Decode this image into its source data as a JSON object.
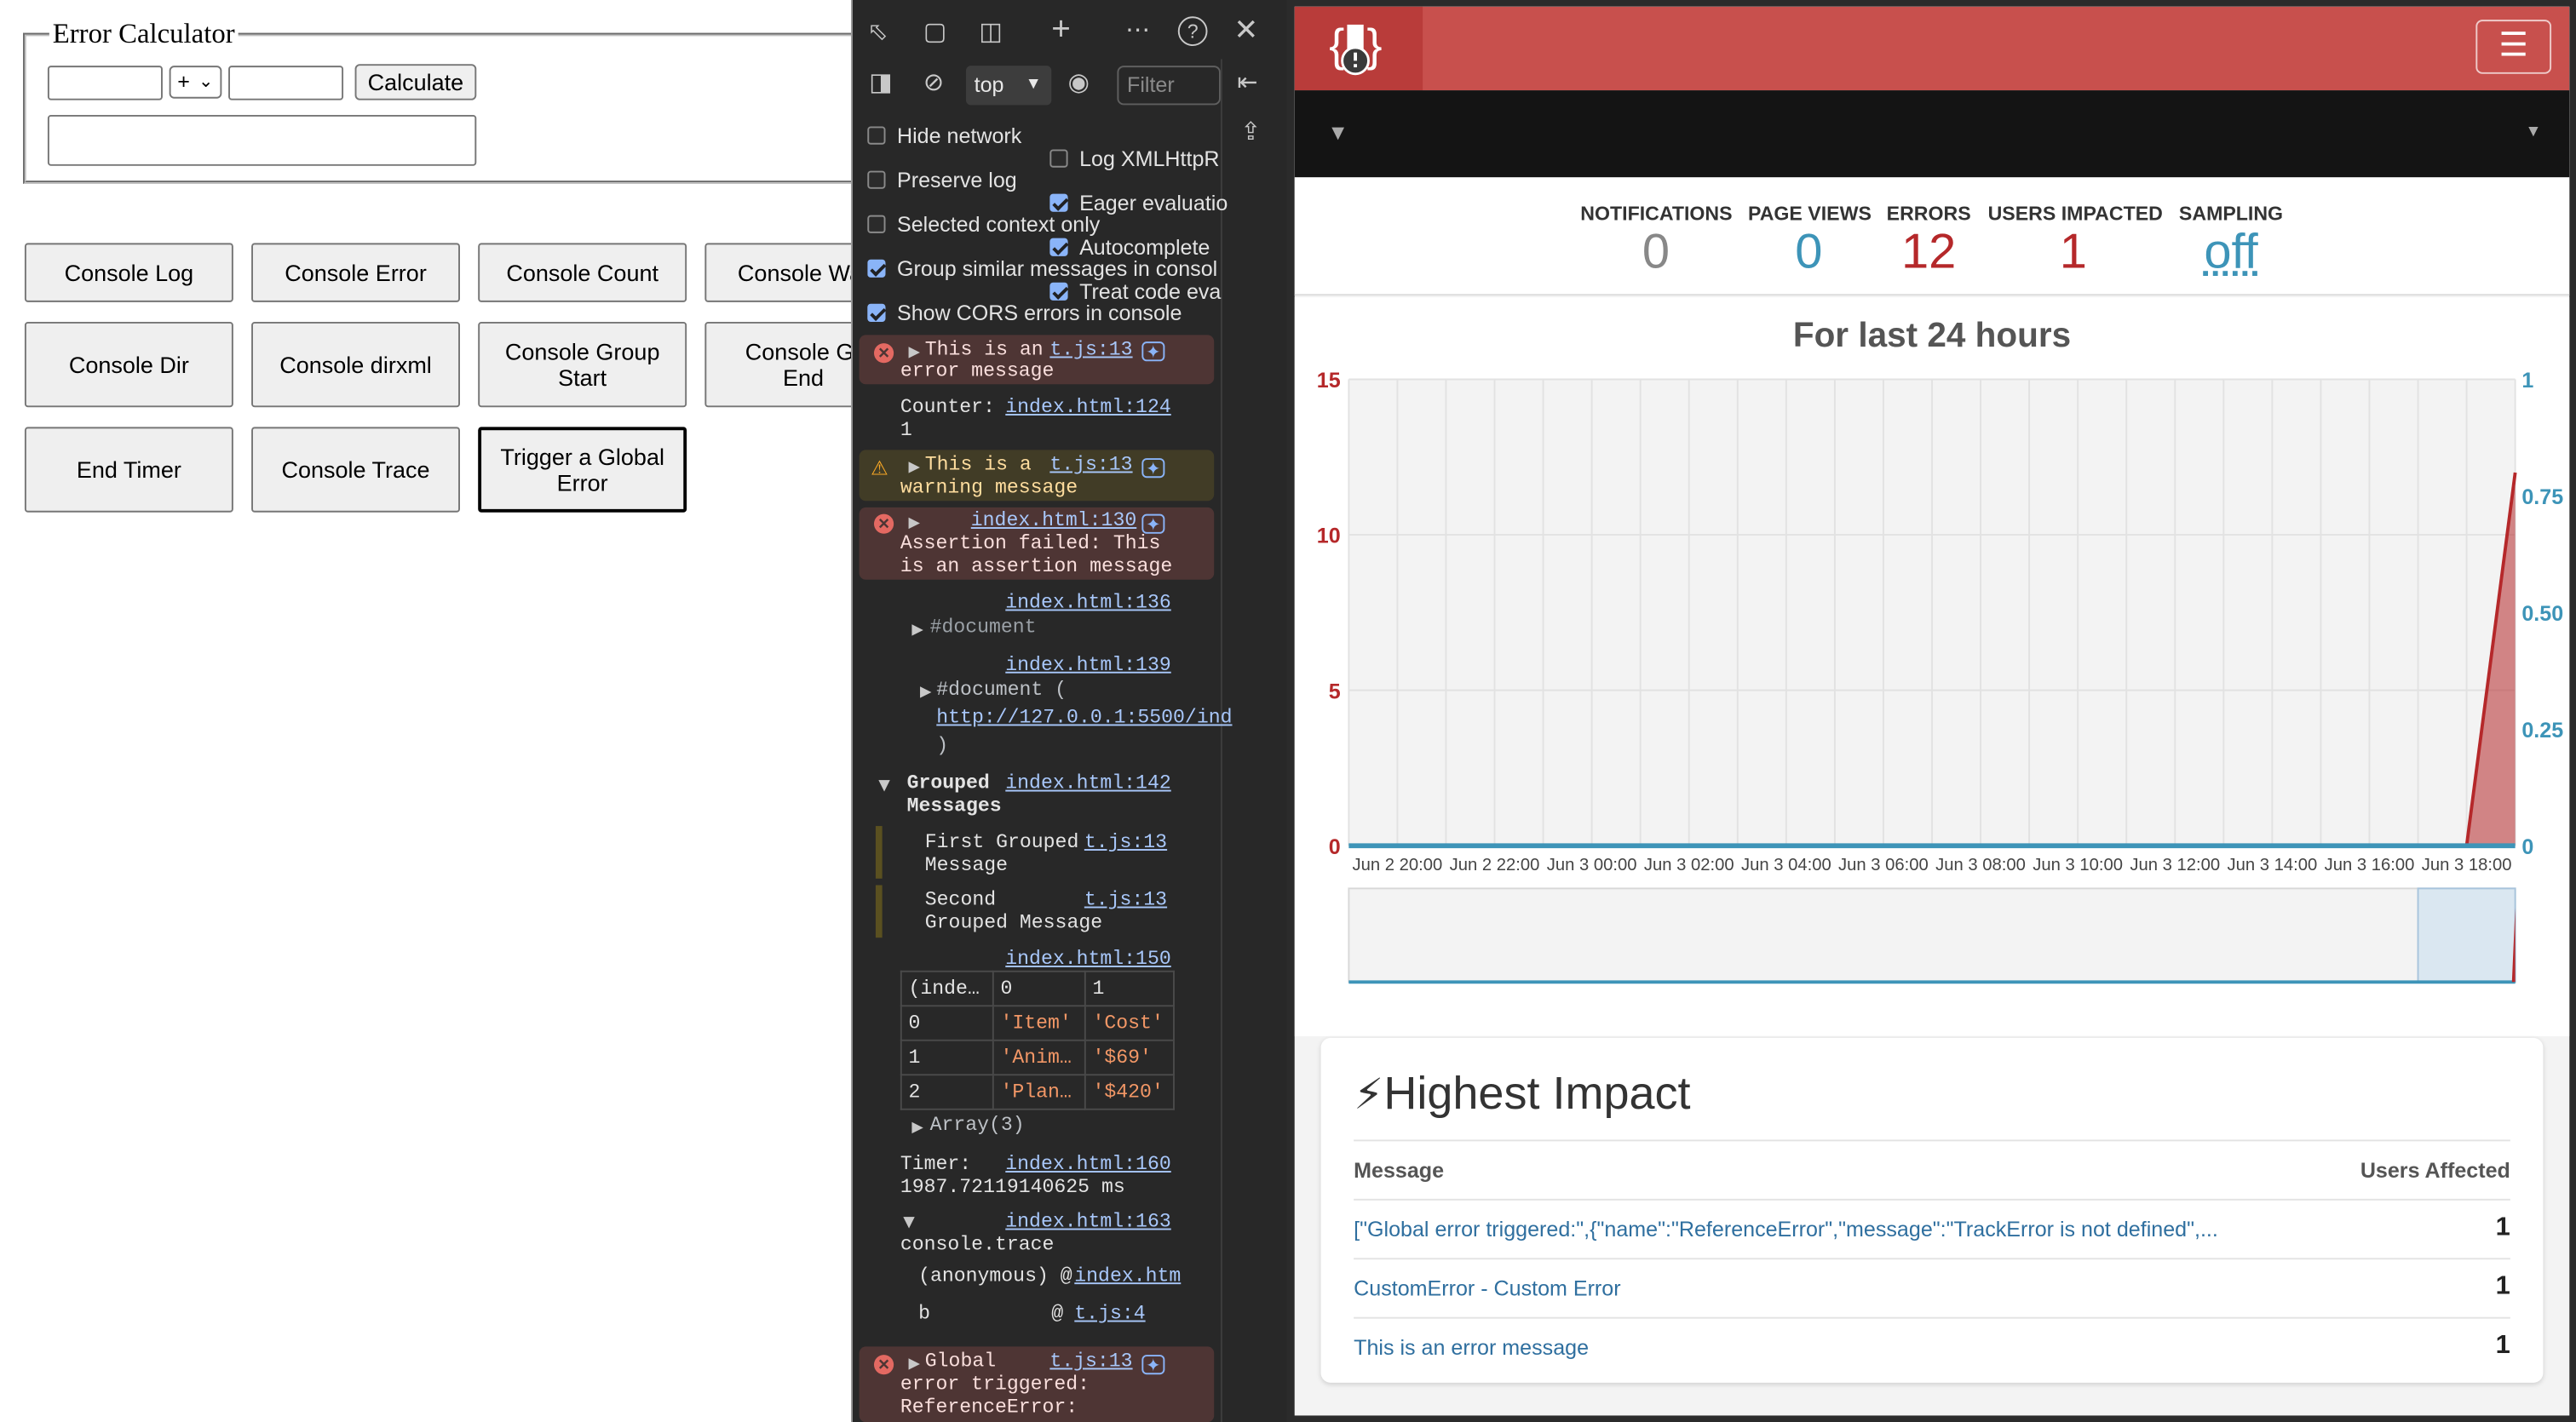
{
  "left_page": {
    "legend": "Error Calculator",
    "operator": "+",
    "calculate_label": "Calculate",
    "buttons": [
      "Console Log",
      "Console Error",
      "Console Count",
      "Console Wa",
      "Console Dir",
      "Console dirxml",
      "Console Group Start",
      "Console Gr End",
      "End Timer",
      "Console Trace",
      "Trigger a Global Error"
    ]
  },
  "devtools": {
    "context": "top",
    "filter_placeholder": "Filter",
    "settings": [
      {
        "label": "Hide network",
        "checked": false
      },
      {
        "label": "Log XMLHttpR",
        "checked": false
      },
      {
        "label": "Preserve log",
        "checked": false
      },
      {
        "label": "Eager evaluatio",
        "checked": true
      },
      {
        "label": "Selected context only",
        "checked": false
      },
      {
        "label": "Autocomplete",
        "checked": true
      },
      {
        "label": "Group similar messages in consol",
        "checked": true
      },
      {
        "label": "Treat code eva",
        "checked": true
      },
      {
        "label": "Show CORS errors in console",
        "checked": true
      }
    ],
    "messages": {
      "error1_l1": "This is an",
      "error1_l2": "error message",
      "error1_src": "t.js:13",
      "counter_l1": "Counter:",
      "counter_l2": "1",
      "counter_src": "index.html:124",
      "warn_l1": "This is a",
      "warn_l2": "warning message",
      "warn_src": "t.js:13",
      "assert_src": "index.html:130",
      "assert_l1": "Assertion failed: This",
      "assert_l2": "is an assertion message",
      "dir_src": "index.html:136",
      "dir_text": "#document",
      "dirxml_src": "index.html:139",
      "dirxml_l1": "#document (",
      "dirxml_url": "http://127.0.0.1:5500/ind",
      "dirxml_l3": ")",
      "group_l1": "Grouped",
      "group_l2": "Messages",
      "group_src": "index.html:142",
      "g1_l1": "First Grouped",
      "g1_l2": "Message",
      "g1_src": "t.js:13",
      "g2_l1": "Second",
      "g2_l2": "Grouped Message",
      "g2_src": "t.js:13",
      "table_src": "index.html:150",
      "table_header": [
        "(inde…",
        "0",
        "1"
      ],
      "table_rows": [
        [
          "0",
          "'Item'",
          "'Cost'"
        ],
        [
          "1",
          "'Anim…",
          "'$69'"
        ],
        [
          "2",
          "'Plan…",
          "'$420'"
        ]
      ],
      "array_text": "Array(3)",
      "timer_l1": "Timer:",
      "timer_l2": "1987.72119140625 ms",
      "timer_src": "index.html:160",
      "trace_src": "index.html:163",
      "trace_text": "console.trace",
      "trace1_fn": "(anonymous) @",
      "trace1_src": "index.htm",
      "trace2_fn": "b",
      "trace2_at": "@",
      "trace2_src": "t.js:4",
      "global_l1": "Global",
      "global_l2": "error triggered:",
      "global_l3": "ReferenceError:",
      "global_src": "t.js:13"
    }
  },
  "dashboard": {
    "stats": [
      {
        "label": "NOTIFICATIONS",
        "value": "0",
        "color": "#888888"
      },
      {
        "label": "PAGE VIEWS",
        "value": "0",
        "color": "#3d94b8"
      },
      {
        "label": "ERRORS",
        "value": "12",
        "color": "#b5282a"
      },
      {
        "label": "USERS IMPACTED",
        "value": "1",
        "color": "#b5282a"
      },
      {
        "label": "SAMPLING",
        "value": "off",
        "color": "#3d94b8"
      }
    ],
    "chart_title": "For last 24 hours",
    "impact_title": "Highest Impact",
    "impact_col_message": "Message",
    "impact_col_users": "Users Affected",
    "impact_rows": [
      {
        "message": "[\"Global error triggered:\",{\"name\":\"ReferenceError\",\"message\":\"TrackError is not defined\",...",
        "users": "1"
      },
      {
        "message": "CustomError - Custom Error",
        "users": "1"
      },
      {
        "message": "This is an error message",
        "users": "1"
      }
    ]
  },
  "chart_data": {
    "type": "area",
    "title": "For last 24 hours",
    "x": [
      "Jun 2 20:00",
      "Jun 2 22:00",
      "Jun 3 00:00",
      "Jun 3 02:00",
      "Jun 3 04:00",
      "Jun 3 06:00",
      "Jun 3 08:00",
      "Jun 3 10:00",
      "Jun 3 12:00",
      "Jun 3 14:00",
      "Jun 3 16:00",
      "Jun 3 18:00"
    ],
    "y_left_ticks": [
      "0",
      "5",
      "10",
      "15"
    ],
    "y_right_ticks": [
      "0",
      "0.25",
      "0.50",
      "0.75",
      "1"
    ],
    "y_left_range": [
      0,
      15
    ],
    "y_right_range": [
      0,
      1
    ],
    "series": [
      {
        "name": "",
        "axis": "left",
        "color": "#b5282a",
        "points": [
          [
            "Jun 3 18:00",
            0
          ],
          [
            "Jun 3 19:00",
            12
          ]
        ]
      },
      {
        "name": "",
        "axis": "right",
        "color": "#3d94b8",
        "points": [
          [
            "Jun 2 19:00",
            0
          ],
          [
            "Jun 3 19:00",
            0
          ]
        ]
      }
    ],
    "grid": true
  }
}
